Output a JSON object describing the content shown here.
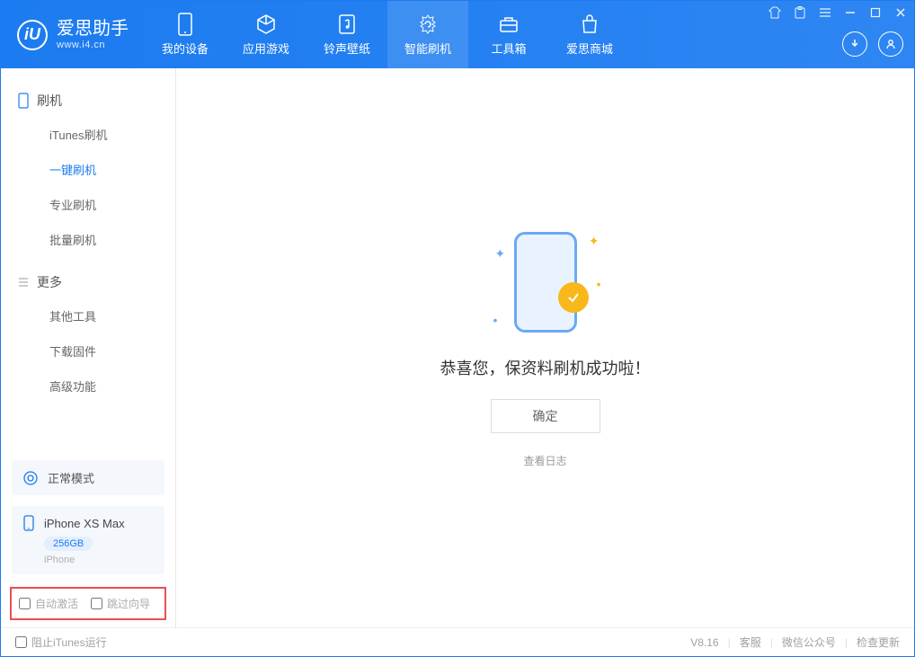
{
  "app": {
    "title": "爱思助手",
    "subtitle": "www.i4.cn"
  },
  "tabs": [
    {
      "label": "我的设备",
      "icon": "device-icon"
    },
    {
      "label": "应用游戏",
      "icon": "cube-icon"
    },
    {
      "label": "铃声壁纸",
      "icon": "music-icon"
    },
    {
      "label": "智能刷机",
      "icon": "refresh-icon",
      "active": true
    },
    {
      "label": "工具箱",
      "icon": "toolbox-icon"
    },
    {
      "label": "爱思商城",
      "icon": "bag-icon"
    }
  ],
  "sidebar": {
    "group1": {
      "title": "刷机",
      "items": [
        {
          "label": "iTunes刷机"
        },
        {
          "label": "一键刷机",
          "active": true
        },
        {
          "label": "专业刷机"
        },
        {
          "label": "批量刷机"
        }
      ]
    },
    "group2": {
      "title": "更多",
      "items": [
        {
          "label": "其他工具"
        },
        {
          "label": "下载固件"
        },
        {
          "label": "高级功能"
        }
      ]
    },
    "mode": {
      "label": "正常模式"
    },
    "device": {
      "name": "iPhone XS Max",
      "storage": "256GB",
      "type": "iPhone"
    },
    "opts": {
      "auto_activate": "自动激活",
      "skip_guide": "跳过向导"
    }
  },
  "main": {
    "message": "恭喜您，保资料刷机成功啦！",
    "ok": "确定",
    "log_link": "查看日志"
  },
  "footer": {
    "block_itunes": "阻止iTunes运行",
    "version": "V8.16",
    "links": [
      "客服",
      "微信公众号",
      "检查更新"
    ]
  }
}
